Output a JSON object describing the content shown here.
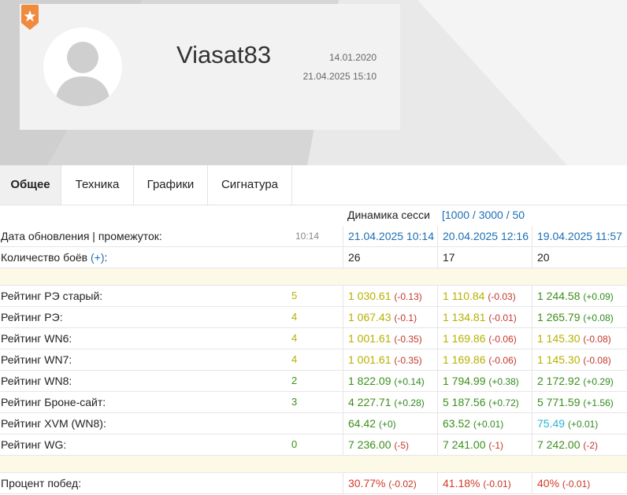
{
  "profile": {
    "username": "Viasat83",
    "registration_date": "14.01.2020",
    "last_seen": "21.04.2025 15:10"
  },
  "tabs": [
    {
      "label": "Общее",
      "active": true
    },
    {
      "label": "Техника",
      "active": false
    },
    {
      "label": "Графики",
      "active": false
    },
    {
      "label": "Сигнатура",
      "active": false
    }
  ],
  "dynamics": {
    "label": "Динамика сесси",
    "range_link": "[1000 / 3000 / 50"
  },
  "update_row": {
    "label": "Дата обновления | промежуток:",
    "clipped_value": "10:14",
    "dates": [
      "21.04.2025 10:14",
      "20.04.2025 12:16",
      "19.04.2025 11:57"
    ]
  },
  "battles_row": {
    "label": "Количество боёв",
    "link": "(+)",
    "suffix": ":",
    "values": [
      "26",
      "17",
      "20"
    ]
  },
  "ratings": [
    {
      "label": "Рейтинг РЭ старый:",
      "clip": "5",
      "cells": [
        {
          "value": "1 030.61",
          "delta": "(-0.13)",
          "color": "yellow",
          "sign": "neg"
        },
        {
          "value": "1 110.84",
          "delta": "(-0.03)",
          "color": "yellow",
          "sign": "neg"
        },
        {
          "value": "1 244.58",
          "delta": "(+0.09)",
          "color": "green",
          "sign": "pos"
        }
      ]
    },
    {
      "label": "Рейтинг РЭ:",
      "clip": "4",
      "cells": [
        {
          "value": "1 067.43",
          "delta": "(-0.1)",
          "color": "yellow",
          "sign": "neg"
        },
        {
          "value": "1 134.81",
          "delta": "(-0.01)",
          "color": "yellow",
          "sign": "neg"
        },
        {
          "value": "1 265.79",
          "delta": "(+0.08)",
          "color": "green",
          "sign": "pos"
        }
      ]
    },
    {
      "label": "Рейтинг WN6:",
      "clip": "4",
      "cells": [
        {
          "value": "1 001.61",
          "delta": "(-0.35)",
          "color": "yellow",
          "sign": "neg"
        },
        {
          "value": "1 169.86",
          "delta": "(-0.06)",
          "color": "yellow",
          "sign": "neg"
        },
        {
          "value": "1 145.30",
          "delta": "(-0.08)",
          "color": "yellow",
          "sign": "neg"
        }
      ]
    },
    {
      "label": "Рейтинг WN7:",
      "clip": "4",
      "cells": [
        {
          "value": "1 001.61",
          "delta": "(-0.35)",
          "color": "yellow",
          "sign": "neg"
        },
        {
          "value": "1 169.86",
          "delta": "(-0.06)",
          "color": "yellow",
          "sign": "neg"
        },
        {
          "value": "1 145.30",
          "delta": "(-0.08)",
          "color": "yellow",
          "sign": "neg"
        }
      ]
    },
    {
      "label": "Рейтинг WN8:",
      "clip": "2",
      "cells": [
        {
          "value": "1 822.09",
          "delta": "(+0.14)",
          "color": "green",
          "sign": "pos"
        },
        {
          "value": "1 794.99",
          "delta": "(+0.38)",
          "color": "green",
          "sign": "pos"
        },
        {
          "value": "2 172.92",
          "delta": "(+0.29)",
          "color": "green",
          "sign": "pos"
        }
      ]
    },
    {
      "label": "Рейтинг Броне-сайт:",
      "clip": "3",
      "cells": [
        {
          "value": "4 227.71",
          "delta": "(+0.28)",
          "color": "green",
          "sign": "pos"
        },
        {
          "value": "5 187.56",
          "delta": "(+0.72)",
          "color": "green",
          "sign": "pos"
        },
        {
          "value": "5 771.59",
          "delta": "(+1.56)",
          "color": "green",
          "sign": "pos"
        }
      ]
    },
    {
      "label": "Рейтинг XVM (WN8):",
      "clip": "",
      "cells": [
        {
          "value": "64.42",
          "delta": "(+0)",
          "color": "green",
          "sign": "pos"
        },
        {
          "value": "63.52",
          "delta": "(+0.01)",
          "color": "green",
          "sign": "pos"
        },
        {
          "value": "75.49",
          "delta": "(+0.01)",
          "color": "cyan",
          "sign": "pos"
        }
      ]
    },
    {
      "label": "Рейтинг WG:",
      "clip": "0",
      "cells": [
        {
          "value": "7 236.00",
          "delta": "(-5)",
          "color": "green",
          "sign": "neg"
        },
        {
          "value": "7 241.00",
          "delta": "(-1)",
          "color": "green",
          "sign": "neg"
        },
        {
          "value": "7 242.00",
          "delta": "(-2)",
          "color": "green",
          "sign": "neg"
        }
      ]
    }
  ],
  "winrate_row": {
    "label": "Процент побед:",
    "cells": [
      {
        "value": "30.77%",
        "delta": "(-0.02)"
      },
      {
        "value": "41.18%",
        "delta": "(-0.01)"
      },
      {
        "value": "40%",
        "delta": "(-0.01)"
      }
    ]
  },
  "colors": {
    "yellow": "#b5b100",
    "green": "#3c8f1a",
    "cyan": "#2bb1d6",
    "red": "#d23a2a",
    "link": "#1a6fb5",
    "badge": "#f08a3c"
  }
}
